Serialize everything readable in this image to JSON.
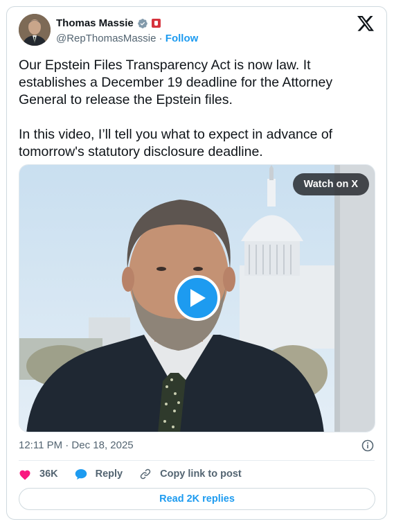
{
  "author": {
    "name": "Thomas Massie",
    "handle": "@RepThomasMassie",
    "separator": "·",
    "follow_label": "Follow"
  },
  "tweet": {
    "text": "Our Epstein Files Transparency Act is now law. It establishes a December 19 deadline for the Attorney General to release the Epstein files.\n\nIn this video, I’ll tell you what to expect in advance of tomorrow's statutory disclosure deadline."
  },
  "media": {
    "watch_label": "Watch on X"
  },
  "meta": {
    "timestamp": "12:11 PM · Dec 18, 2025"
  },
  "actions": {
    "likes_count": "36K",
    "reply_label": "Reply",
    "copy_link_label": "Copy link to post"
  },
  "replies_button_label": "Read 2K replies",
  "colors": {
    "accent": "#1d9bf0",
    "like": "#f91880",
    "muted": "#536471"
  }
}
